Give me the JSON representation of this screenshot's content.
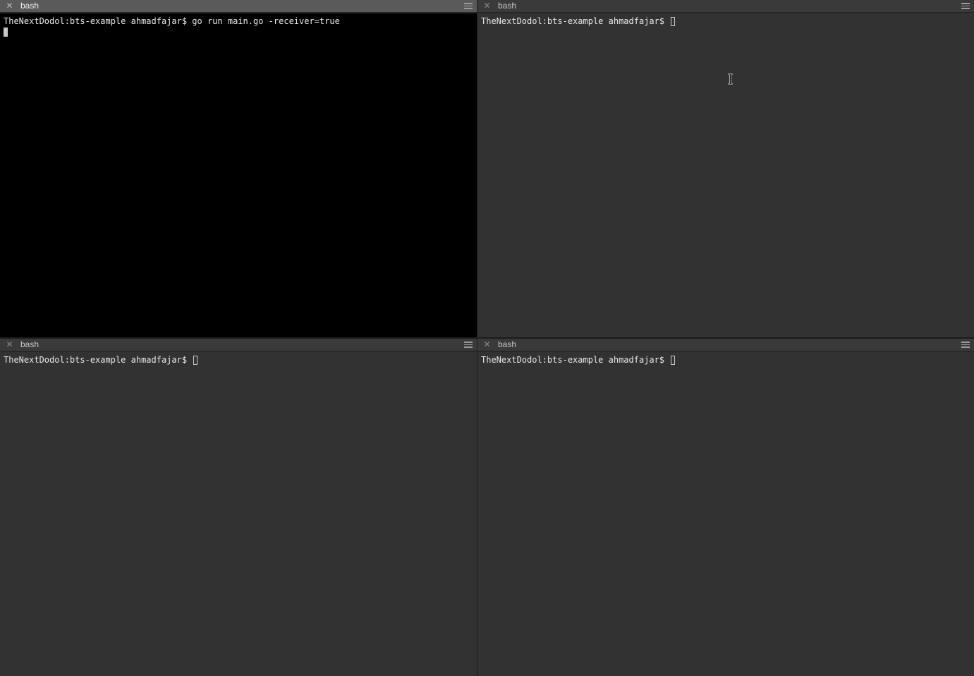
{
  "app": {
    "panes": [
      {
        "id": "top-left",
        "tab_title": "bash",
        "active": true,
        "lines": [
          "TheNextDodol:bts-example ahmadfajar$ go run main.go -receiver=true"
        ]
      },
      {
        "id": "top-right",
        "tab_title": "bash",
        "active": false,
        "prompt": "TheNextDodol:bts-example ahmadfajar$"
      },
      {
        "id": "bottom-left",
        "tab_title": "bash",
        "active": false,
        "prompt": "TheNextDodol:bts-example ahmadfajar$"
      },
      {
        "id": "bottom-right",
        "tab_title": "bash",
        "active": false,
        "prompt": "TheNextDodol:bts-example ahmadfajar$"
      }
    ],
    "icons": {
      "close": "close-icon",
      "menu": "hamburger-menu-icon",
      "mouse_cursor": "text-ibeam-cursor-icon"
    },
    "colors": {
      "active_terminal_bg": "#000000",
      "inactive_terminal_bg": "#323232",
      "active_tab_bg": "#5a5a5a",
      "inactive_tab_bg": "#3a3a3a",
      "text": "#e8e8e8"
    }
  }
}
